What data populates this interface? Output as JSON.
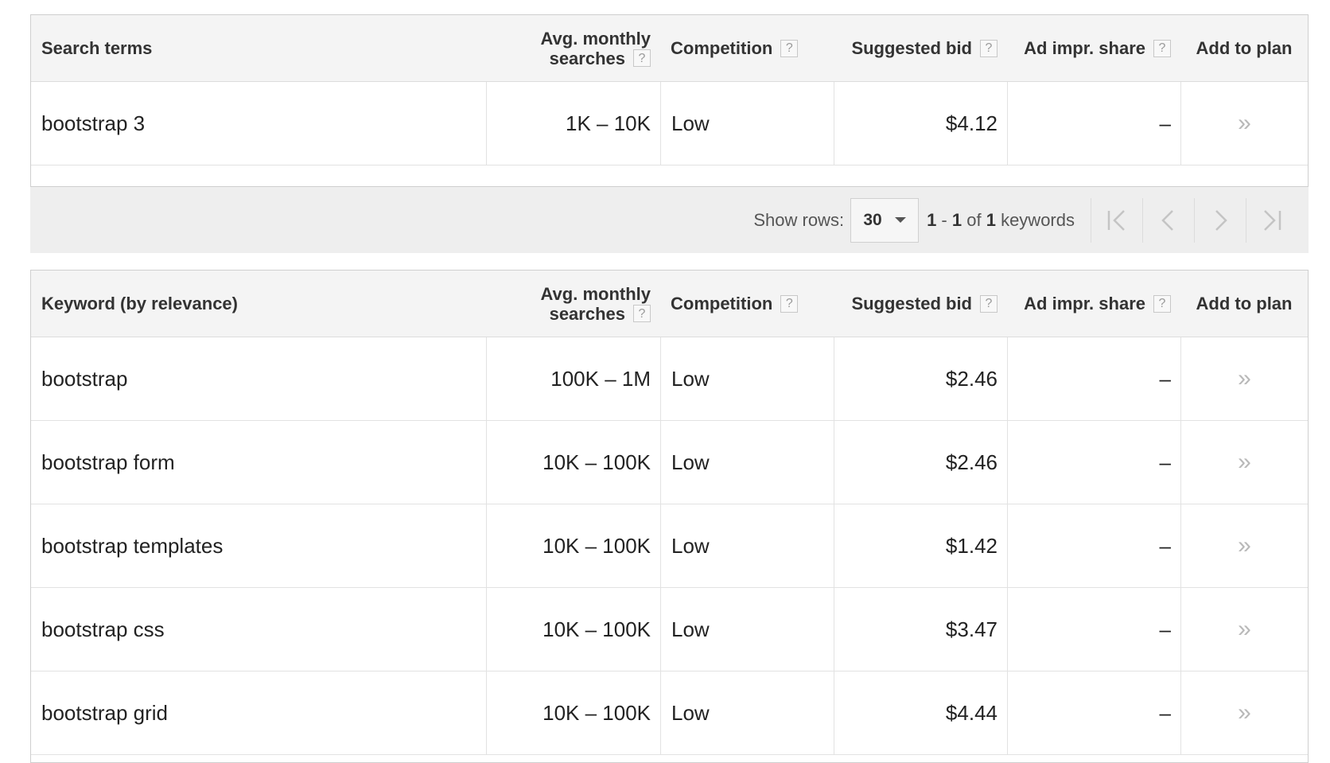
{
  "columns": {
    "avg_line1": "Avg. monthly",
    "avg_line2": "searches",
    "competition": "Competition",
    "suggested_bid": "Suggested bid",
    "ad_impr_share": "Ad impr. share",
    "add_to_plan": "Add to plan",
    "help": "?"
  },
  "search_terms_table": {
    "title": "Search terms",
    "rows": [
      {
        "term": "bootstrap 3",
        "avg": "1K – 10K",
        "competition": "Low",
        "bid": "$4.12",
        "share": "–",
        "add": "»"
      }
    ]
  },
  "pager": {
    "show_rows_label": "Show rows:",
    "rows_value": "30",
    "range_start": "1",
    "range_sep": " - ",
    "range_end": "1",
    "range_of": " of ",
    "range_total": "1",
    "range_unit": " keywords"
  },
  "keywords_table": {
    "title": "Keyword (by relevance)",
    "rows": [
      {
        "term": "bootstrap",
        "avg": "100K – 1M",
        "competition": "Low",
        "bid": "$2.46",
        "share": "–",
        "add": "»"
      },
      {
        "term": "bootstrap form",
        "avg": "10K – 100K",
        "competition": "Low",
        "bid": "$2.46",
        "share": "–",
        "add": "»"
      },
      {
        "term": "bootstrap templates",
        "avg": "10K – 100K",
        "competition": "Low",
        "bid": "$1.42",
        "share": "–",
        "add": "»"
      },
      {
        "term": "bootstrap css",
        "avg": "10K – 100K",
        "competition": "Low",
        "bid": "$3.47",
        "share": "–",
        "add": "»"
      },
      {
        "term": "bootstrap grid",
        "avg": "10K – 100K",
        "competition": "Low",
        "bid": "$4.44",
        "share": "–",
        "add": "»"
      }
    ]
  },
  "colors": {
    "header_bg": "#f4f4f4",
    "pager_bg": "#eeeeee",
    "border": "#cfcfcf",
    "add_icon": "#b9b9b9"
  }
}
